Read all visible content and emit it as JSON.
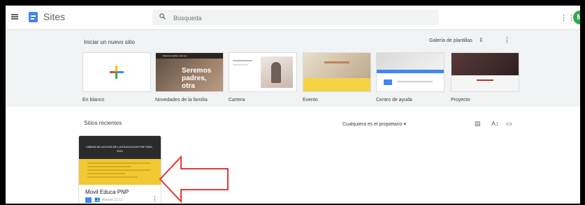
{
  "header": {
    "app_title": "Sites",
    "search_placeholder": "Búsqueda",
    "avatar_letter": "M"
  },
  "templates": {
    "section_title": "Iniciar un nuevo sitio",
    "gallery_label": "Galería de plantillas",
    "items": [
      {
        "label": "En blanco"
      },
      {
        "label": "Novedades de la familia",
        "overlay_text": "Seremos padres, otra",
        "header_text": "Seremos padres, otra vez"
      },
      {
        "label": "Cartera"
      },
      {
        "label": "Evento"
      },
      {
        "label": "Centro de ayuda"
      },
      {
        "label": "Proyecto"
      }
    ]
  },
  "recents": {
    "section_title": "Sitios recientes",
    "owner_filter": "Cualquiera es el propietario ▾",
    "sites": [
      {
        "title": "Movil Educa PNP",
        "date": "Abierto 12:11",
        "thumbnail_header": "LINEAS DE ACCION DE LA EDUCACION PNP 2020 - 2021"
      }
    ]
  },
  "colors": {
    "brand_blue": "#4285f4",
    "avatar_green": "#34a853",
    "card_yellow": "#f2c833",
    "arrow_red": "#e53935"
  }
}
